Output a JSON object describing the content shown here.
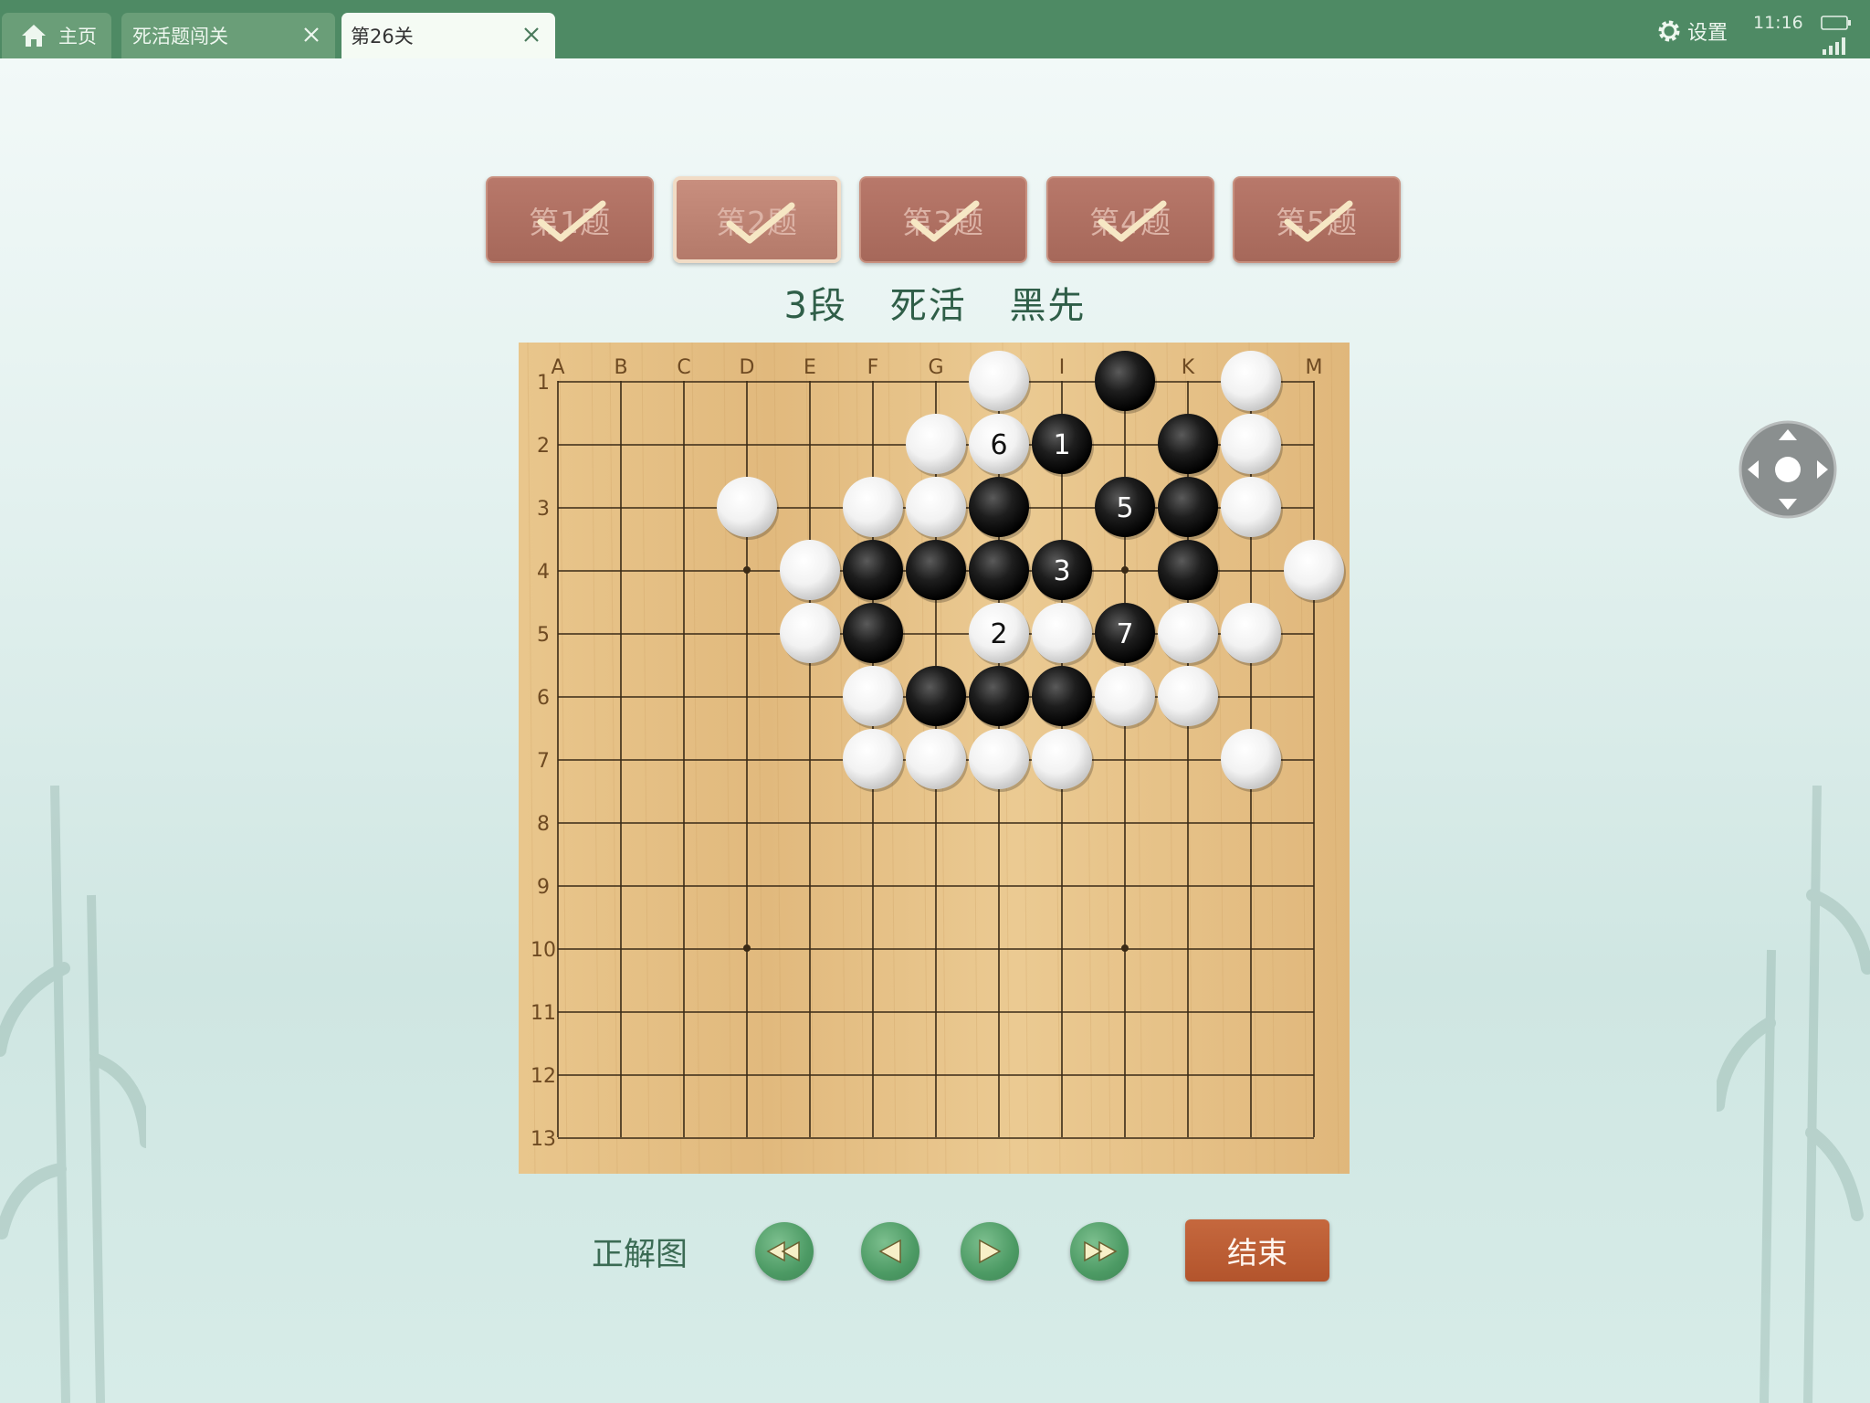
{
  "tabs": [
    {
      "label": "主页",
      "icon": "home-icon"
    },
    {
      "label": "死活题闯关",
      "icon": "close-icon"
    },
    {
      "label": "第26关",
      "icon": "close-icon",
      "active": true
    }
  ],
  "status": {
    "settings_label": "设置",
    "time": "11:16"
  },
  "problems": [
    {
      "label": "第1题",
      "solved": true
    },
    {
      "label": "第2题",
      "solved": true,
      "active": true
    },
    {
      "label": "第3题",
      "solved": true
    },
    {
      "label": "第4题",
      "solved": true
    },
    {
      "label": "第5题",
      "solved": true
    }
  ],
  "problem_info": {
    "level": "3段",
    "type": "死活",
    "turn": "黑先"
  },
  "board": {
    "size": 13,
    "col_labels": [
      "A",
      "B",
      "C",
      "D",
      "E",
      "F",
      "G",
      "H",
      "I",
      "J",
      "K",
      "L",
      "M"
    ],
    "visible_col_labels": [
      "A",
      "B",
      "C",
      "D",
      "E",
      "F",
      "G",
      "",
      "I",
      "",
      "K",
      "",
      "M"
    ],
    "row_labels": [
      "1",
      "2",
      "3",
      "4",
      "5",
      "6",
      "7",
      "8",
      "9",
      "10",
      "11",
      "12",
      "13"
    ],
    "star_points": [
      "D4",
      "J4",
      "D10",
      "J10"
    ],
    "stones": [
      {
        "pos": "H1",
        "color": "white"
      },
      {
        "pos": "J1",
        "color": "black"
      },
      {
        "pos": "L1",
        "color": "white"
      },
      {
        "pos": "G2",
        "color": "white"
      },
      {
        "pos": "H2",
        "color": "white",
        "label": "6"
      },
      {
        "pos": "I2",
        "color": "black",
        "label": "1"
      },
      {
        "pos": "K2",
        "color": "black"
      },
      {
        "pos": "L2",
        "color": "white"
      },
      {
        "pos": "D3",
        "color": "white"
      },
      {
        "pos": "F3",
        "color": "white"
      },
      {
        "pos": "G3",
        "color": "white"
      },
      {
        "pos": "H3",
        "color": "black"
      },
      {
        "pos": "J3",
        "color": "black",
        "label": "5"
      },
      {
        "pos": "K3",
        "color": "black"
      },
      {
        "pos": "L3",
        "color": "white"
      },
      {
        "pos": "E4",
        "color": "white"
      },
      {
        "pos": "F4",
        "color": "black"
      },
      {
        "pos": "G4",
        "color": "black"
      },
      {
        "pos": "H4",
        "color": "black"
      },
      {
        "pos": "I4",
        "color": "black",
        "label": "3"
      },
      {
        "pos": "K4",
        "color": "black"
      },
      {
        "pos": "M4",
        "color": "white"
      },
      {
        "pos": "E5",
        "color": "white"
      },
      {
        "pos": "F5",
        "color": "black"
      },
      {
        "pos": "H5",
        "color": "white",
        "label": "2"
      },
      {
        "pos": "I5",
        "color": "white"
      },
      {
        "pos": "J5",
        "color": "black",
        "label": "7"
      },
      {
        "pos": "K5",
        "color": "white"
      },
      {
        "pos": "L5",
        "color": "white"
      },
      {
        "pos": "F6",
        "color": "white"
      },
      {
        "pos": "G6",
        "color": "black"
      },
      {
        "pos": "H6",
        "color": "black"
      },
      {
        "pos": "I6",
        "color": "black"
      },
      {
        "pos": "J6",
        "color": "white"
      },
      {
        "pos": "K6",
        "color": "white"
      },
      {
        "pos": "F7",
        "color": "white"
      },
      {
        "pos": "G7",
        "color": "white"
      },
      {
        "pos": "H7",
        "color": "white"
      },
      {
        "pos": "I7",
        "color": "white"
      },
      {
        "pos": "L7",
        "color": "white"
      }
    ]
  },
  "controls": {
    "solution_label": "正解图",
    "buttons": [
      {
        "name": "first-move-button",
        "icon": "rewind-icon"
      },
      {
        "name": "prev-move-button",
        "icon": "play-left-icon"
      },
      {
        "name": "next-move-button",
        "icon": "play-right-icon"
      },
      {
        "name": "last-move-button",
        "icon": "fast-forward-icon"
      }
    ],
    "end_label": "结束"
  },
  "colors": {
    "topbar": "#4e8a64",
    "board": "#e6c187",
    "button_brown": "#a6685a",
    "end_button": "#b3542c",
    "title_text": "#2f5e48"
  }
}
